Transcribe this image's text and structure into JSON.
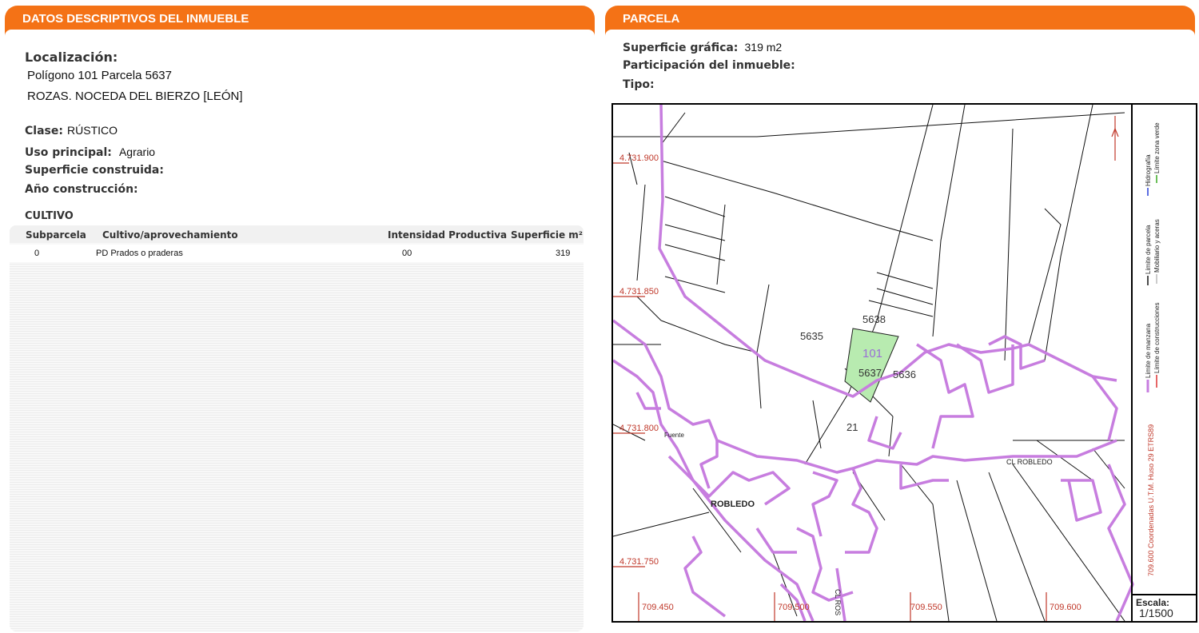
{
  "left_panel": {
    "title": "DATOS DESCRIPTIVOS DEL INMUEBLE",
    "localizacion_label": "Localización:",
    "localizacion_line1": "Polígono 101 Parcela 5637",
    "localizacion_line2": "ROZAS. NOCEDA DEL BIERZO [LEÓN]",
    "clase_label": "Clase:",
    "clase_value": "RÚSTICO",
    "uso_label": "Uso principal:",
    "uso_value": "Agrario",
    "superficie_construida_label": "Superficie construida:",
    "anio_label": "Año construcción:",
    "cultivo": {
      "title": "CULTIVO",
      "columns": [
        "Subparcela",
        "Cultivo/aprovechamiento",
        "Intensidad Productiva",
        "Superficie m²"
      ],
      "rows": [
        [
          "0",
          "PD Prados o praderas",
          "00",
          "319"
        ]
      ]
    }
  },
  "right_panel": {
    "title": "PARCELA",
    "superficie_label": "Superficie gráfica:",
    "superficie_value": "319 m2",
    "participacion_label": "Participación del inmueble:",
    "tipo_label": "Tipo:"
  },
  "map": {
    "y_coords": [
      "4.731.900",
      "4.731.850",
      "4.731.800",
      "4.731.750"
    ],
    "x_coords": [
      "709.450",
      "709.500",
      "709.550",
      "709.600"
    ],
    "parcel_labels": [
      "5638",
      "5635",
      "101",
      "5637",
      "5636",
      "21"
    ],
    "street_labels": [
      "CL ROBLEDO",
      "ROBLEDO",
      "Fuente",
      "CL ROS"
    ],
    "legend": [
      "Hidrografía",
      "Límite zona verde",
      "Límite de parcela",
      "Mobiliario y aceras",
      "Límite de manzana",
      "Límite de construcciones"
    ],
    "crs_note": "709.600 Coordenadas U.T.M. Huso 29 ETRS89",
    "scale_label": "Escala:",
    "scale_value": "1/1500",
    "colors": {
      "manzana": "#c77ddf",
      "highlight_fill": "#b8ebb0",
      "coords": "#c0392b",
      "hidrografia": "#5b6ee1",
      "zona_verde": "#6bbf59",
      "construcciones": "#d33"
    }
  },
  "colors": {
    "header_bg": "#f47216",
    "header_text": "#ffffff"
  }
}
